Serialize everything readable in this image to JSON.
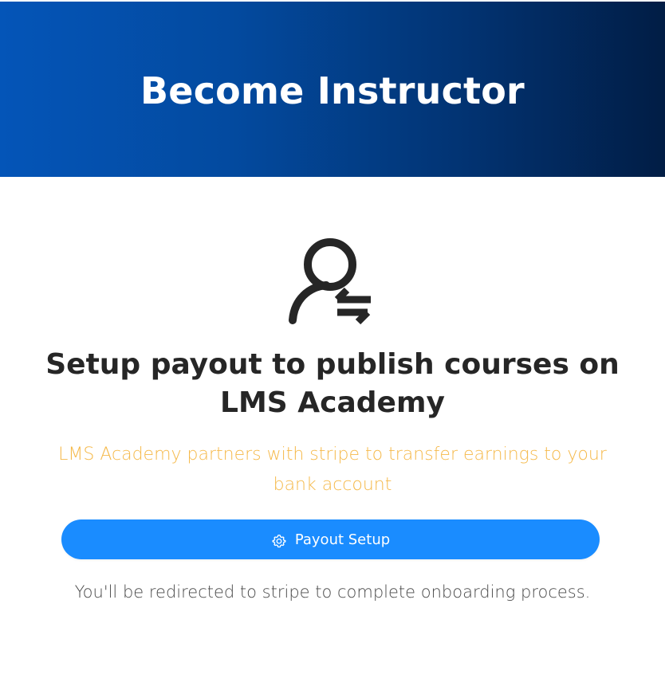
{
  "hero": {
    "title": "Become Instructor"
  },
  "main": {
    "icon": "person-arrows-icon",
    "headline": "Setup payout to publish courses on LMS Academy",
    "subline": "LMS Academy partners with stripe to transfer earnings to your bank account",
    "button": {
      "icon": "gear-icon",
      "label": "Payout Setup"
    },
    "note": "You'll be redirected to stripe to complete onboarding process."
  },
  "colors": {
    "hero_gradient_start": "#0455b8",
    "hero_gradient_end": "#011d45",
    "button": "#1a8cff",
    "subline": "#f5b94a",
    "headline": "#262626"
  }
}
